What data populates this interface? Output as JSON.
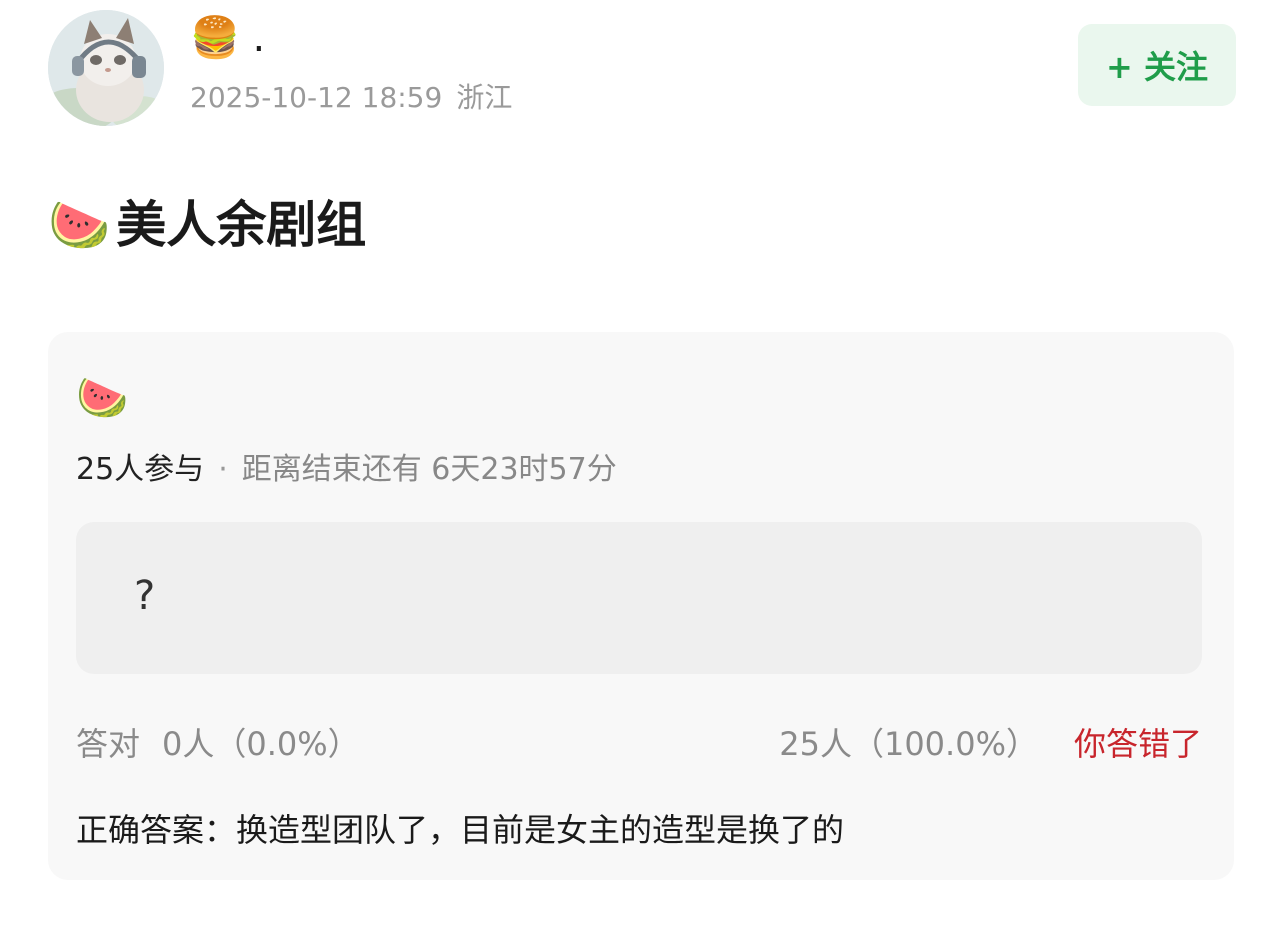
{
  "post": {
    "author": "🍔 .",
    "timestamp": "2025-10-12 18:59",
    "location": "浙江",
    "follow_label": "+ 关注",
    "title_emoji": "🍉",
    "title": "美人余剧组"
  },
  "poll": {
    "emoji": "🍉",
    "participants": "25人参与",
    "separator": "·",
    "remaining": "距离结束还有 6天23时57分",
    "option_text": "?",
    "correct_label": "答对",
    "correct_count": "0人（0.0%）",
    "wrong_count": "25人（100.0%）",
    "wrong_label": "你答错了",
    "answer": "正确答案：换造型团队了，目前是女主的造型是换了的"
  },
  "colors": {
    "follow_text": "#1f9d4a",
    "follow_bg": "#eaf7ee",
    "wrong_text": "#c8252c"
  }
}
